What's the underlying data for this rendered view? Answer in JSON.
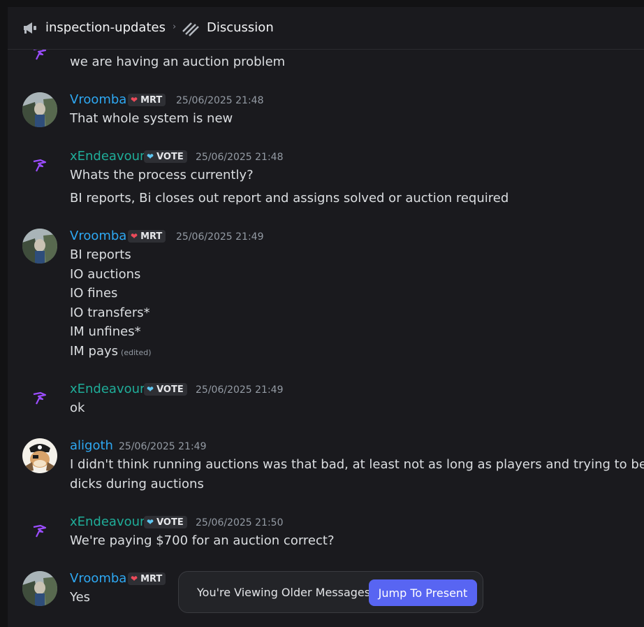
{
  "header": {
    "channel": "inspection-updates",
    "thread": "Discussion"
  },
  "messages": [
    {
      "continuation": true,
      "lines": [
        "we are having an auction problem"
      ]
    },
    {
      "author": "Vroomba",
      "badge": "MRT",
      "time": "25/06/2025 21:48",
      "lines": [
        "That whole system is new"
      ]
    },
    {
      "author": "xEndeavour",
      "badge": "VOTE",
      "time": "25/06/2025 21:48",
      "lines": [
        "Whats the process currently?",
        "BI reports, Bi closes out report and assigns solved or auction required"
      ]
    },
    {
      "author": "Vroomba",
      "badge": "MRT",
      "time": "25/06/2025 21:49",
      "lines": [
        "BI reports",
        "IO auctions",
        "IO fines",
        "IO transfers*",
        "IM unfines*",
        "IM pays"
      ],
      "edited": "(edited)"
    },
    {
      "author": "xEndeavour",
      "badge": "VOTE",
      "time": "25/06/2025 21:49",
      "lines": [
        "ok"
      ]
    },
    {
      "author": "aligoth",
      "time": "25/06/2025 21:49",
      "lines": [
        "I didn't think running auctions was that bad, at least not as long as players and trying to be",
        "dicks during auctions"
      ]
    },
    {
      "author": "xEndeavour",
      "badge": "VOTE",
      "time": "25/06/2025 21:50",
      "lines": [
        "We're paying $700 for an auction correct?"
      ]
    },
    {
      "author": "Vroomba",
      "badge": "MRT",
      "lines": [
        "Yes"
      ]
    }
  ],
  "toast": {
    "label": "You're Viewing Older Messages",
    "button": "Jump To Present"
  },
  "colors": {
    "background": "#1a1a1e",
    "link_blue": "#2ea8f2",
    "teal_name": "#1fad99",
    "button": "#5865f2"
  }
}
